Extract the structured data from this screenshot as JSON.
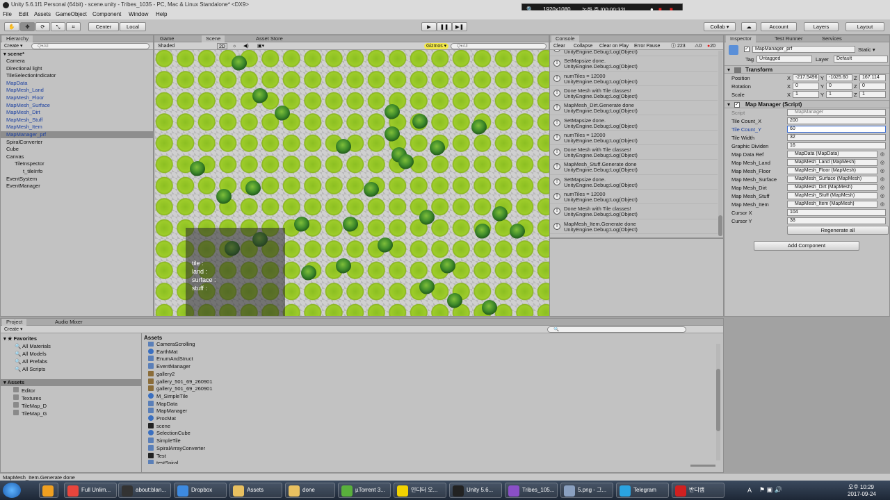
{
  "window": {
    "title": "Unity 5.6.1f1 Personal (64bit) - scene.unity - Tribes_1035 - PC, Mac & Linux Standalone* <DX9>"
  },
  "recorder": {
    "resolution": "1920x1080",
    "status": "녹화 중 [00:00:32]"
  },
  "menu": [
    "File",
    "Edit",
    "Assets",
    "GameObject",
    "Component",
    "Window",
    "Help"
  ],
  "toolbar": {
    "center": "Center",
    "local": "Local",
    "collab": "Collab ▾",
    "account": "Account",
    "layers": "Layers",
    "layout": "Layout"
  },
  "hierarchy": {
    "tab": "Hierarchy",
    "create": "Create ▾",
    "search": "Q▾All",
    "scene": "scene*",
    "items": [
      {
        "label": "Camera",
        "indent": 1,
        "prefab": false
      },
      {
        "label": "Directional light",
        "indent": 1,
        "prefab": false
      },
      {
        "label": "TileSelectionIndicator",
        "indent": 1,
        "prefab": false
      },
      {
        "label": "MapData",
        "indent": 1,
        "prefab": true
      },
      {
        "label": "MapMesh_Land",
        "indent": 1,
        "prefab": true
      },
      {
        "label": "MapMesh_Floor",
        "indent": 1,
        "prefab": true
      },
      {
        "label": "MapMesh_Surface",
        "indent": 1,
        "prefab": true
      },
      {
        "label": "MapMesh_Dirt",
        "indent": 1,
        "prefab": true
      },
      {
        "label": "MapMesh_Stuff",
        "indent": 1,
        "prefab": true
      },
      {
        "label": "MapMesh_Item",
        "indent": 1,
        "prefab": true
      },
      {
        "label": "MapManager_prf",
        "indent": 1,
        "prefab": true,
        "selected": true
      },
      {
        "label": "SpiralConverter",
        "indent": 1,
        "prefab": false
      },
      {
        "label": "Cube",
        "indent": 1,
        "prefab": false
      },
      {
        "label": "Canvas",
        "indent": 1,
        "prefab": false
      },
      {
        "label": "TileInspector",
        "indent": 2,
        "prefab": false
      },
      {
        "label": "t_tileInfo",
        "indent": 3,
        "prefab": false
      },
      {
        "label": "EventSystem",
        "indent": 1,
        "prefab": false
      },
      {
        "label": "EventManager",
        "indent": 1,
        "prefab": false
      }
    ]
  },
  "scene": {
    "tabs": [
      "Game",
      "Scene",
      "Asset Store"
    ],
    "shading": "Shaded",
    "mode2d": "2D",
    "gizmos": "Gizmos ▾",
    "search": "Q▾All",
    "tileinfo": [
      "tile :",
      "land :",
      "surface :",
      "stuff :"
    ]
  },
  "console": {
    "tab": "Console",
    "buttons": [
      "Clear",
      "Collapse",
      "Clear on Play",
      "Error Pause"
    ],
    "counts": {
      "info": "223",
      "warn": "0",
      "error": "20"
    },
    "logs": [
      {
        "l1": "",
        "l2": "UnityEngine.Debug:Log(Object)"
      },
      {
        "l1": "SetMapsize done.",
        "l2": "UnityEngine.Debug:Log(Object)"
      },
      {
        "l1": "numTiles = 12000",
        "l2": "UnityEngine.Debug:Log(Object)"
      },
      {
        "l1": "Done Mesh with Tile classes!",
        "l2": "UnityEngine.Debug:Log(Object)"
      },
      {
        "l1": "MapMesh_Dirt.Generate done",
        "l2": "UnityEngine.Debug:Log(Object)"
      },
      {
        "l1": "SetMapsize done.",
        "l2": "UnityEngine.Debug:Log(Object)"
      },
      {
        "l1": "numTiles = 12000",
        "l2": "UnityEngine.Debug:Log(Object)"
      },
      {
        "l1": "Done Mesh with Tile classes!",
        "l2": "UnityEngine.Debug:Log(Object)"
      },
      {
        "l1": "MapMesh_Stuff.Generate done",
        "l2": "UnityEngine.Debug:Log(Object)"
      },
      {
        "l1": "SetMapsize done.",
        "l2": "UnityEngine.Debug:Log(Object)"
      },
      {
        "l1": "numTiles = 12000",
        "l2": "UnityEngine.Debug:Log(Object)"
      },
      {
        "l1": "Done Mesh with Tile classes!",
        "l2": "UnityEngine.Debug:Log(Object)"
      },
      {
        "l1": "MapMesh_Item.Generate done",
        "l2": "UnityEngine.Debug:Log(Object)"
      }
    ]
  },
  "inspector": {
    "tabs": [
      "Inspector",
      "Test Runner",
      "Services"
    ],
    "object_name": "MapManager_prf",
    "static": "Static ▾",
    "tag_label": "Tag",
    "tag_value": "Untagged",
    "layer_label": "Layer",
    "layer_value": "Default",
    "transform": {
      "title": "Transform",
      "rows": [
        {
          "label": "Position",
          "x": "-217.5496",
          "y": "-1025.60",
          "z": "167.114"
        },
        {
          "label": "Rotation",
          "x": "0",
          "y": "0",
          "z": "0"
        },
        {
          "label": "Scale",
          "x": "1",
          "y": "1",
          "z": "1"
        }
      ]
    },
    "script": {
      "title": "Map Manager (Script)",
      "script_label": "Script",
      "script_value": "MapManager",
      "fields": [
        {
          "label": "Tile Count_X",
          "value": "200",
          "obj": false
        },
        {
          "label": "Tile Count_Y",
          "value": "60",
          "obj": false,
          "active": true
        },
        {
          "label": "Tile Width",
          "value": "32",
          "obj": false
        },
        {
          "label": "Graphic Dividen",
          "value": "16",
          "obj": false
        },
        {
          "label": "Map Data Ref",
          "value": "MapData (MapData)",
          "obj": true
        },
        {
          "label": "Map Mesh_Land",
          "value": "MapMesh_Land (MapMesh)",
          "obj": true
        },
        {
          "label": "Map Mesh_Floor",
          "value": "MapMesh_Floor (MapMesh)",
          "obj": true
        },
        {
          "label": "Map Mesh_Surface",
          "value": "MapMesh_Surface (MapMesh)",
          "obj": true
        },
        {
          "label": "Map Mesh_Dirt",
          "value": "MapMesh_Dirt (MapMesh)",
          "obj": true
        },
        {
          "label": "Map Mesh_Stuff",
          "value": "MapMesh_Stuff (MapMesh)",
          "obj": true
        },
        {
          "label": "Map Mesh_Item",
          "value": "MapMesh_Item (MapMesh)",
          "obj": true
        },
        {
          "label": "Cursor X",
          "value": "104",
          "obj": false
        },
        {
          "label": "Cursor Y",
          "value": "38",
          "obj": false
        }
      ],
      "regenerate": "Regenerate all"
    },
    "add_component": "Add Component"
  },
  "project": {
    "tabs": [
      "Project",
      "Audio Mixer"
    ],
    "create": "Create ▾",
    "favorites": {
      "title": "Favorites",
      "items": [
        "All Materials",
        "All Models",
        "All Prefabs",
        "All Scripts"
      ]
    },
    "assets_root": "Assets",
    "folders": [
      "Editor",
      "Textures",
      "TileMap_D",
      "TileMap_G"
    ],
    "breadcrumb": "Assets",
    "assets": [
      {
        "name": "CameraScrolling",
        "kind": "script"
      },
      {
        "name": "EarthMat",
        "kind": "material"
      },
      {
        "name": "EnumAndStruct",
        "kind": "script"
      },
      {
        "name": "EventManager",
        "kind": "script"
      },
      {
        "name": "gallery2",
        "kind": "texture"
      },
      {
        "name": "gallery_501_69_260901",
        "kind": "texture"
      },
      {
        "name": "gallery_501_69_260901",
        "kind": "texture"
      },
      {
        "name": "M_SimpleTile",
        "kind": "material"
      },
      {
        "name": "MapData",
        "kind": "script"
      },
      {
        "name": "MapManager",
        "kind": "script"
      },
      {
        "name": "ProcMat",
        "kind": "material"
      },
      {
        "name": "scene",
        "kind": "scene"
      },
      {
        "name": "SelectionCube",
        "kind": "material"
      },
      {
        "name": "SimpleTile",
        "kind": "script"
      },
      {
        "name": "SpiralArrayConverter",
        "kind": "script"
      },
      {
        "name": "Test",
        "kind": "scene"
      },
      {
        "name": "testSpiral",
        "kind": "script"
      }
    ]
  },
  "status": "MapMesh_Item.Generate done",
  "taskbar": {
    "items": [
      {
        "label": "",
        "color": "#f0a020"
      },
      {
        "label": "Full Unlim...",
        "color": "#e8453c"
      },
      {
        "label": "about:blan...",
        "color": "#333333"
      },
      {
        "label": "Dropbox",
        "color": "#3d8ae0"
      },
      {
        "label": "Assets",
        "color": "#e8c060"
      },
      {
        "label": "done",
        "color": "#e8c060"
      },
      {
        "label": "µTorrent 3...",
        "color": "#59b03c"
      },
      {
        "label": "인디터 오...",
        "color": "#f2d200"
      },
      {
        "label": "Unity 5.6...",
        "color": "#222222"
      },
      {
        "label": "Tribes_105...",
        "color": "#8a4fc7"
      },
      {
        "label": "5.png - 그...",
        "color": "#8aa0c0"
      },
      {
        "label": "Telegram",
        "color": "#2aa3e0"
      },
      {
        "label": "반디캠",
        "color": "#d02020"
      }
    ],
    "tray": {
      "lang": "A",
      "time": "오후 10:29",
      "date": "2017-09-24"
    }
  },
  "colors": {
    "prefab_blue": "#1a3fa0",
    "selection": "#8e8e8e",
    "grass": "#9dcc2a",
    "record_red": "#e02020"
  }
}
